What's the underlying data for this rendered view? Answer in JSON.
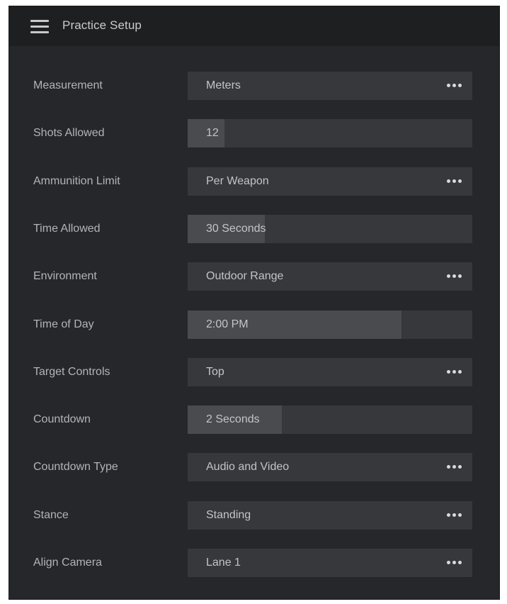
{
  "header": {
    "title": "Practice Setup",
    "menu_icon": "hamburger-menu-icon"
  },
  "settings": [
    {
      "label": "Measurement",
      "type": "select",
      "value": "Meters",
      "icon": "more-options-icon"
    },
    {
      "label": "Shots Allowed",
      "type": "slider",
      "value": "12",
      "level": 0.13
    },
    {
      "label": "Ammunition Limit",
      "type": "select",
      "value": "Per Weapon",
      "icon": "more-options-icon"
    },
    {
      "label": "Time Allowed",
      "type": "slider",
      "value": "30 Seconds",
      "level": 0.27
    },
    {
      "label": "Environment",
      "type": "select",
      "value": "Outdoor Range",
      "icon": "more-options-icon"
    },
    {
      "label": "Time of Day",
      "type": "slider",
      "value": "2:00 PM",
      "level": 0.75
    },
    {
      "label": "Target Controls",
      "type": "select",
      "value": "Top",
      "icon": "more-options-icon"
    },
    {
      "label": "Countdown",
      "type": "slider",
      "value": "2 Seconds",
      "level": 0.33
    },
    {
      "label": "Countdown Type",
      "type": "select",
      "value": "Audio and Video",
      "icon": "more-options-icon"
    },
    {
      "label": "Stance",
      "type": "select",
      "value": "Standing",
      "icon": "more-options-icon"
    },
    {
      "label": "Align Camera",
      "type": "select",
      "value": "Lane 1",
      "icon": "more-options-icon"
    }
  ]
}
